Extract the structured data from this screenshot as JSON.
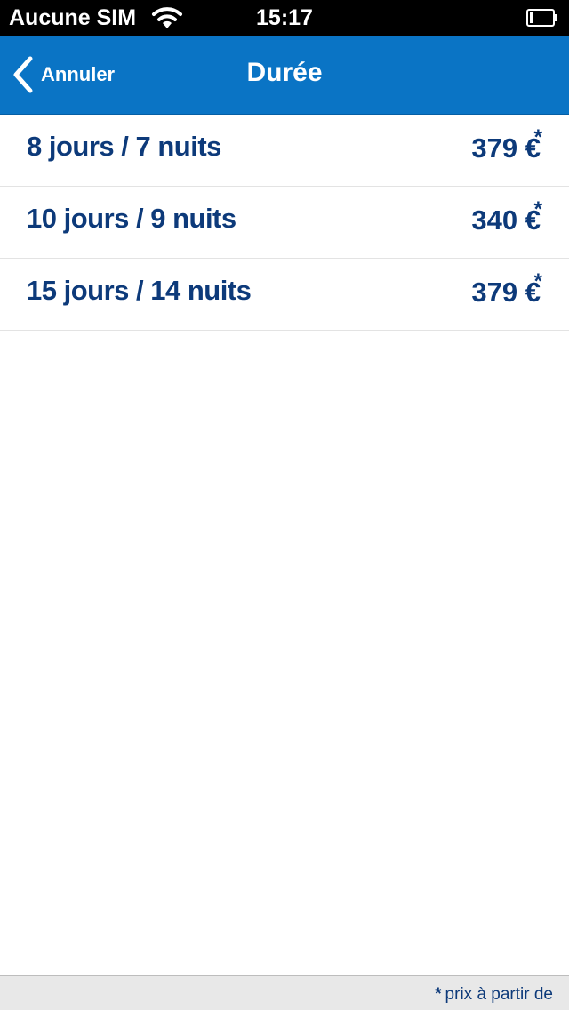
{
  "status_bar": {
    "carrier": "Aucune SIM",
    "time": "15:17",
    "wifi_icon": "wifi-icon",
    "battery_icon": "battery-icon"
  },
  "nav_bar": {
    "back_label": "Annuler",
    "back_icon": "chevron-left-icon",
    "title": "Durée",
    "background_color": "#0a74c5"
  },
  "durations": [
    {
      "label": "8 jours / 7 nuits",
      "price": "379 €",
      "marker": "*"
    },
    {
      "label": "10 jours / 9 nuits",
      "price": "340 €",
      "marker": "*"
    },
    {
      "label": "15 jours / 14 nuits",
      "price": "379 €",
      "marker": "*"
    }
  ],
  "footer": {
    "marker": "*",
    "note": "prix à partir de"
  },
  "colors": {
    "text_primary": "#0d3a7a",
    "accent": "#0a74c5"
  }
}
